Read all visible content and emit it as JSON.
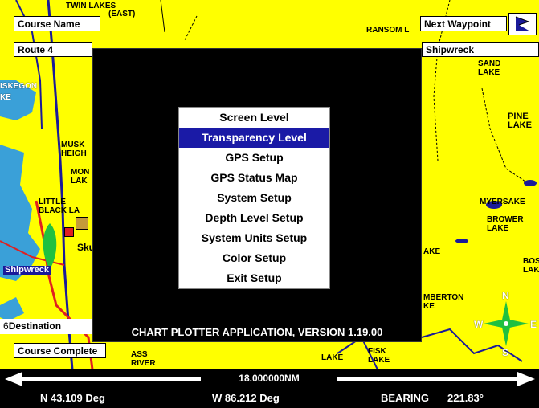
{
  "map": {
    "labels": {
      "twin_lakes": "TWIN LAKES",
      "east": "(EAST)",
      "ransom": "RANSOM L",
      "iskegon": "ISKEGON",
      "ke": "KE",
      "musk_heigh": "MUSK HEIGH",
      "mon_lak": "MON LAK",
      "little_black": "LITTLE BLACK LA",
      "skul": "Skul",
      "shipwreck_label": "Shipwreck",
      "sand_lake": "SAND LAKE",
      "pine_lake": "PINE LAKE",
      "myers_lake": "MYERSAKE",
      "brower_lake": "BROWER LAKE",
      "ake": "AKE",
      "bostw_lake": "BOSTW LAKE",
      "mberton": "MBERTON",
      "ke2": "KE",
      "lake_bottom": "LAKE",
      "fisk_lake": "FISK LAKE",
      "ass_river": "ASS RIVER",
      "compass_n": "N",
      "compass_w": "W",
      "compass_e": "E",
      "compass_s": "S"
    }
  },
  "fields": {
    "course_name_label": "Course Name",
    "course_name_value": "Route 4",
    "next_waypoint_label": "Next Waypoint",
    "next_waypoint_value": "Shipwreck",
    "destination_label": "Destination",
    "destination_prefix": "6",
    "course_complete": "Course Complete"
  },
  "menu": {
    "items": [
      {
        "label": "Screen Level"
      },
      {
        "label": "Transparency Level"
      },
      {
        "label": "GPS Setup"
      },
      {
        "label": "GPS Status Map"
      },
      {
        "label": "System Setup"
      },
      {
        "label": "Depth Level Setup"
      },
      {
        "label": "System Units Setup"
      },
      {
        "label": "Color Setup"
      },
      {
        "label": "Exit Setup"
      }
    ],
    "selected_index": 1
  },
  "version_text": "CHART PLOTTER APPLICATION, VERSION 1.19.00",
  "scale": {
    "label": "18.000000NM"
  },
  "status": {
    "lat": "N  43.109 Deg",
    "lon": "W  86.212 Deg",
    "bearing_label": "BEARING",
    "bearing_value": "221.83°"
  },
  "colors": {
    "land": "#ffff00",
    "water": "#3aa0d8",
    "highlight": "#1a1aa6",
    "road_red": "#e02020",
    "road_blue": "#1a1a9a"
  },
  "icons": [
    "waypoint-flag-icon",
    "boat-icon",
    "skull-icon",
    "compass-icon"
  ]
}
